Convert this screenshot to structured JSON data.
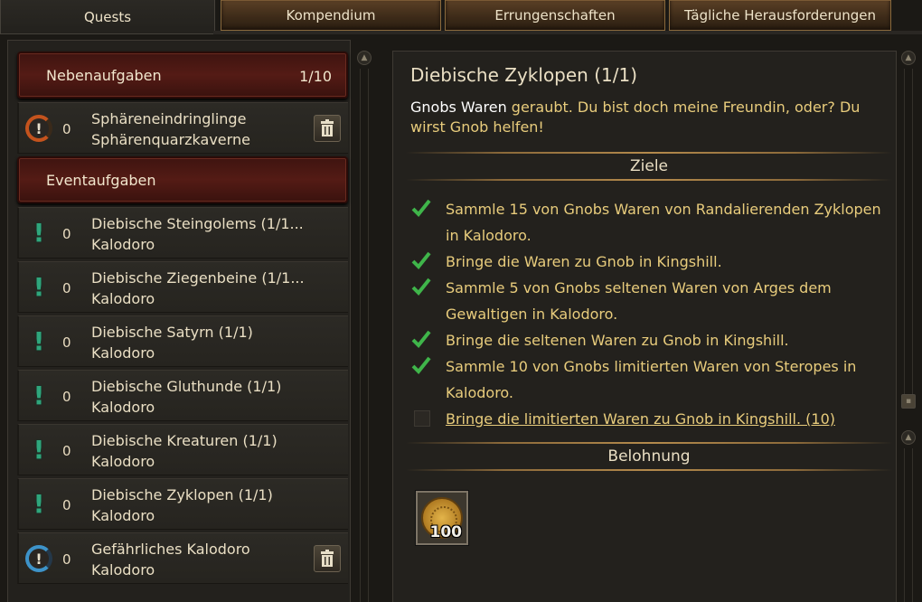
{
  "tabs": [
    {
      "label": "Quests",
      "active": true
    },
    {
      "label": "Kompendium"
    },
    {
      "label": "Errungenschaften"
    },
    {
      "label": "Tägliche Herausforderungen"
    }
  ],
  "sidebar": {
    "categories": [
      {
        "label": "Nebenaufgaben",
        "count": "1/10"
      },
      {
        "label": "Eventaufgaben"
      }
    ],
    "side_quests": [
      {
        "icon": "orange-quest-ring-icon",
        "number": "0",
        "line1": "Sphäreneindringlinge",
        "line2": "Sphärenquarzkaverne",
        "deletable": true
      }
    ],
    "event_quests": [
      {
        "icon": "green-exclamation-icon",
        "number": "0",
        "line1": "Diebische Steingolems (1/1...",
        "line2": "Kalodoro"
      },
      {
        "icon": "green-exclamation-icon",
        "number": "0",
        "line1": "Diebische Ziegenbeine (1/1...",
        "line2": "Kalodoro"
      },
      {
        "icon": "green-exclamation-icon",
        "number": "0",
        "line1": "Diebische Satyrn (1/1)",
        "line2": "Kalodoro"
      },
      {
        "icon": "green-exclamation-icon",
        "number": "0",
        "line1": "Diebische Gluthunde (1/1)",
        "line2": "Kalodoro"
      },
      {
        "icon": "green-exclamation-icon",
        "number": "0",
        "line1": "Diebische Kreaturen (1/1)",
        "line2": "Kalodoro"
      },
      {
        "icon": "green-exclamation-icon",
        "number": "0",
        "line1": "Diebische Zyklopen (1/1)",
        "line2": "Kalodoro"
      },
      {
        "icon": "blue-quest-ring-icon",
        "number": "0",
        "line1": "Gefährliches Kalodoro",
        "line2": "Kalodoro",
        "deletable": true
      }
    ]
  },
  "detail": {
    "title": "Diebische Zyklopen (1/1)",
    "description_highlight": "Gnobs Waren",
    "description_rest": " geraubt. Du bist doch meine Freundin, oder? Du wirst Gnob helfen!",
    "objectives_heading": "Ziele",
    "objectives": [
      {
        "text": "Sammle 15 von Gnobs Waren von Randalierenden Zyklopen in Kalodoro.",
        "done": true
      },
      {
        "text": "Bringe die Waren zu Gnob in Kingshill.",
        "done": true
      },
      {
        "text": "Sammle 5 von Gnobs seltenen Waren von Arges dem Gewaltigen in Kalodoro.",
        "done": true
      },
      {
        "text": "Bringe die seltenen Waren zu Gnob in Kingshill.",
        "done": true
      },
      {
        "text": "Sammle 10 von Gnobs limitierten Waren von Steropes in Kalodoro.",
        "done": true
      },
      {
        "text": "Bringe die limitierten Waren zu Gnob in Kingshill. (10)",
        "done": false
      }
    ],
    "reward_heading": "Belohnung",
    "reward": {
      "icon": "gold-coin-icon",
      "amount": "100"
    }
  },
  "colors": {
    "accent_gold": "#e8cc7c",
    "category_red": "#541b15",
    "check_green": "#3fb54a",
    "exclamation_green": "#2fa67c"
  }
}
